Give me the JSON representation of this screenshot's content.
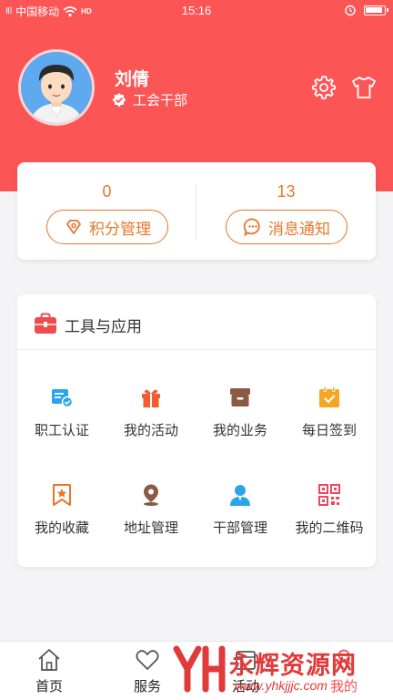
{
  "status_bar": {
    "signal": "Ⅱl",
    "carrier": "中国移动",
    "network": "HD",
    "time": "15:16"
  },
  "profile": {
    "name": "刘倩",
    "role": "工会干部"
  },
  "stats": {
    "points_count": "0",
    "points_label": "积分管理",
    "messages_count": "13",
    "messages_label": "消息通知"
  },
  "tools": {
    "title": "工具与应用",
    "items": [
      {
        "label": "职工认证",
        "icon": "certification-icon",
        "color": "#2aa6e8"
      },
      {
        "label": "我的活动",
        "icon": "gift-icon",
        "color": "#f25d2f"
      },
      {
        "label": "我的业务",
        "icon": "archive-box-icon",
        "color": "#8a5a44"
      },
      {
        "label": "每日签到",
        "icon": "calendar-check-icon",
        "color": "#f5a623"
      },
      {
        "label": "我的收藏",
        "icon": "bookmark-star-icon",
        "color": "#e8762b"
      },
      {
        "label": "地址管理",
        "icon": "location-pin-icon",
        "color": "#8a5a44"
      },
      {
        "label": "干部管理",
        "icon": "person-icon",
        "color": "#2aa6e8"
      },
      {
        "label": "我的二维码",
        "icon": "qr-code-icon",
        "color": "#e84a5f"
      }
    ]
  },
  "tabbar": {
    "items": [
      {
        "label": "首页",
        "icon": "home-icon"
      },
      {
        "label": "服务",
        "icon": "heart-icon"
      },
      {
        "label": "活动",
        "icon": "activity-icon"
      },
      {
        "label": "我的",
        "icon": "user-icon"
      }
    ]
  },
  "watermark": {
    "logo_text": "YH",
    "brand": "永辉资源网",
    "url": "www.yhkjjjc.com"
  },
  "colors": {
    "header": "#fb5555",
    "accent": "#e8762b",
    "active_tab": "#fb4d4d"
  }
}
